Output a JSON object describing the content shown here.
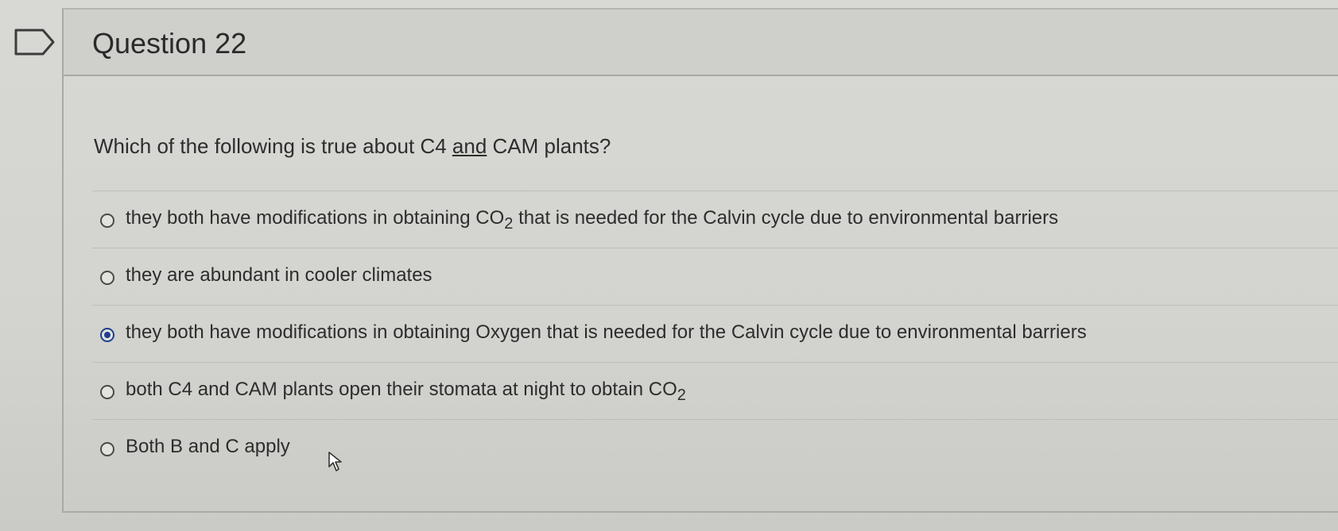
{
  "flag": {
    "icon": "flag-outline-icon"
  },
  "question": {
    "title": "Question 22",
    "prompt_before": "Which of the following is true about C4 ",
    "prompt_underlined": "and",
    "prompt_after": " CAM plants?"
  },
  "answers": [
    {
      "text_before": "they both have modifications in obtaining CO",
      "subscript": "2",
      "text_after": " that is needed for the Calvin cycle due to environmental barriers",
      "selected": false
    },
    {
      "text_before": "they are abundant in cooler climates",
      "subscript": "",
      "text_after": "",
      "selected": false
    },
    {
      "text_before": "they both have modifications in obtaining Oxygen that is needed for the Calvin cycle due to environmental barriers",
      "subscript": "",
      "text_after": "",
      "selected": true
    },
    {
      "text_before": "both C4 and CAM plants open their stomata at night to obtain CO",
      "subscript": "2",
      "text_after": "",
      "selected": false
    },
    {
      "text_before": "Both B and C apply",
      "subscript": "",
      "text_after": "",
      "selected": false
    }
  ],
  "colors": {
    "selected_radio": "#1d3f8c",
    "background": "#d3d3cf"
  },
  "cursor": {
    "icon": "mouse-pointer-icon"
  }
}
